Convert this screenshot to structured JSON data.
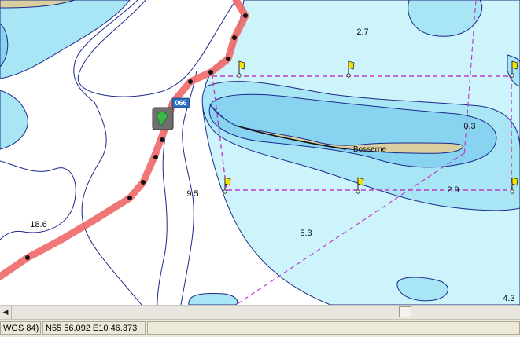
{
  "map": {
    "depth_soundings": [
      "2.7",
      "0.3",
      "2.9",
      "9.5",
      "18.6",
      "5.3",
      "4.3"
    ],
    "place_name": "Bosserne",
    "waypoint_label": "066",
    "colors": {
      "land": "#d9cfa1",
      "shallow_water": "#87d3f0",
      "mid_water": "#a8e6f5",
      "light_water": "#cdf3fb",
      "deep_water": "#ffffff",
      "contour": "#1b2a8a",
      "track": "#f06a6a",
      "boundary": "#c03cc8",
      "flag": "#f2e20a"
    },
    "icons": [
      "route-point-icon",
      "waypoint-flag-icon",
      "vessel-icon"
    ]
  },
  "statusbar": {
    "datum": "WGS 84)",
    "position": "N55 56.092 E10 46.373",
    "extra": ""
  }
}
